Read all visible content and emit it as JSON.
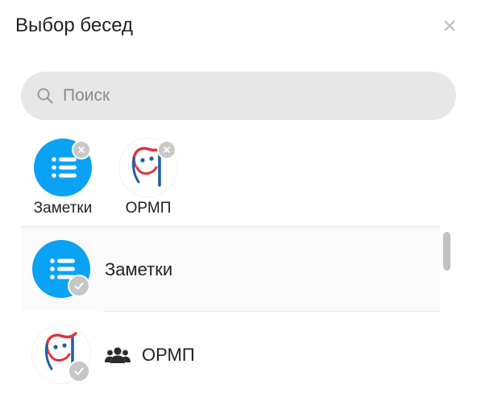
{
  "dialog": {
    "title": "Выбор бесед",
    "close_icon": "close-icon"
  },
  "search": {
    "placeholder": "Поиск",
    "value": "",
    "icon": "search-icon"
  },
  "selected_chips": [
    {
      "label": "Заметки",
      "avatar": "notes-list-icon",
      "remove_icon": "remove-icon"
    },
    {
      "label": "ОРМП",
      "avatar": "ormp-logo",
      "remove_icon": "remove-icon"
    }
  ],
  "list": [
    {
      "name": "Заметки",
      "avatar": "notes-list-icon",
      "checked_icon": "check-icon",
      "group": false,
      "highlighted": true
    },
    {
      "name": "ОРМП",
      "avatar": "ormp-logo",
      "checked_icon": "check-icon",
      "group": true,
      "group_icon": "users-icon",
      "highlighted": false
    }
  ],
  "colors": {
    "accent": "#0aa2f5",
    "search_bg": "#e7e7e7",
    "badge_gray": "#c6c6c6",
    "logo_red": "#e0323c",
    "logo_blue": "#1f5fa8"
  }
}
